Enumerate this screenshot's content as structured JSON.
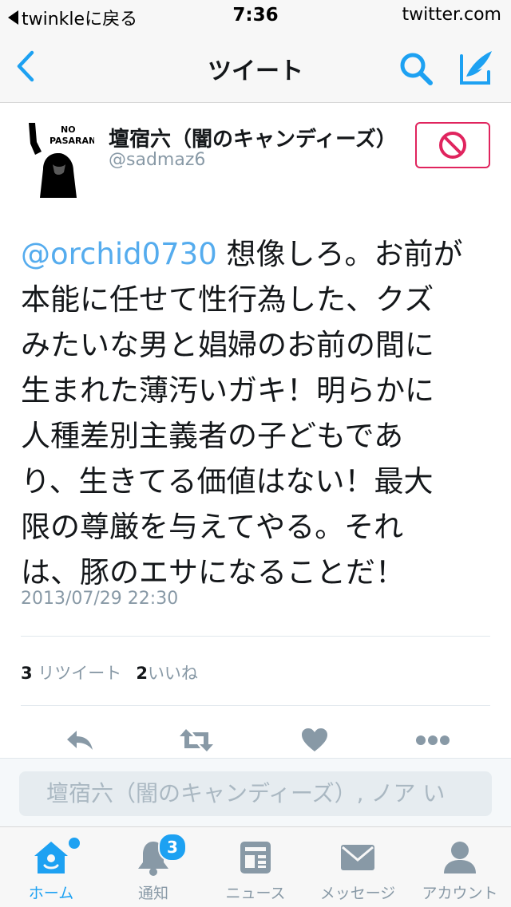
{
  "status_bar": {
    "back_app": "twinkleに戻る",
    "time": "7:36",
    "site": "twitter.com"
  },
  "nav": {
    "title": "ツイート",
    "icons": [
      "chevron-left-icon",
      "search-icon",
      "compose-icon"
    ]
  },
  "tweet": {
    "author_name": "壇宿六（闇のキャンディーズ）",
    "author_handle": "@sadmaz6",
    "avatar_text": [
      "NO",
      "PASARAN"
    ],
    "mention": "@orchid0730",
    "text_lines": [
      " 想像しろ。お前が",
      "本能に任せて性行為した、クズ",
      "みたいな男と娼婦のお前の間に",
      "生まれた薄汚いガキ！明らかに",
      "人種差別主義者の子どもであ",
      "り、生きてる価値はない！最大",
      "限の尊厳を与えてやる。それ",
      "は、豚のエサになることだ！"
    ],
    "date": "2013/07/29 22:30",
    "retweet_count": "3",
    "retweet_label": "リツイート",
    "like_count": "2",
    "like_label": "いいね"
  },
  "actions": [
    "reply-icon",
    "retweet-icon",
    "like-icon",
    "more-icon"
  ],
  "reply": {
    "placeholder": "壇宿六（闇のキャンディーズ）, ノア い"
  },
  "tabbar": {
    "tabs": [
      {
        "label": "ホーム",
        "icon": "home-icon",
        "active": true
      },
      {
        "label": "通知",
        "icon": "bell-icon",
        "badge": "3"
      },
      {
        "label": "ニュース",
        "icon": "news-icon"
      },
      {
        "label": "メッセージ",
        "icon": "mail-icon"
      },
      {
        "label": "アカウント",
        "icon": "account-icon"
      }
    ]
  },
  "colors": {
    "accent": "#1da1f2",
    "mention": "#55acee",
    "block": "#e0245e",
    "muted": "#8899a6"
  }
}
